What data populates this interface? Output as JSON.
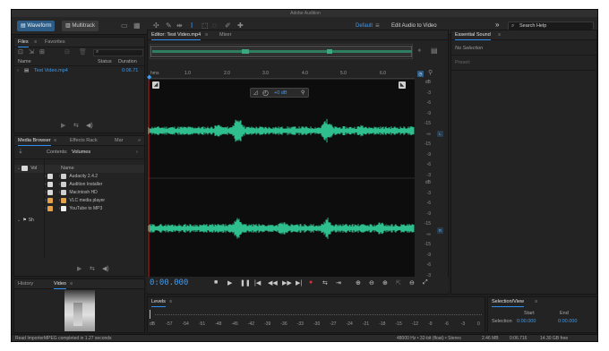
{
  "window": {
    "title": "Adobe Audition"
  },
  "toolbar": {
    "waveform_label": "Waveform",
    "multitrack_label": "Multitrack",
    "workspace_label": "Default",
    "edit_audio_video_label": "Edit Audio to Video",
    "search_placeholder": "Search Help"
  },
  "files_panel": {
    "tabs": [
      "Files",
      "Favorites"
    ],
    "columns": {
      "name": "Name",
      "status": "Status",
      "duration": "Duration"
    },
    "files": [
      {
        "name": "Test Video.mp4",
        "duration": "0:06.71"
      }
    ]
  },
  "media_browser": {
    "tabs": [
      "Media Browser",
      "Effects Rack",
      "Mar"
    ],
    "contents_label": "Contents:",
    "contents_value": "Volumes",
    "left_items": [
      "Vol",
      "Sh"
    ],
    "name_header": "Name",
    "items": [
      "Audacity 2.4.2",
      "Audition Installer",
      "Macintosh HD",
      "VLC media player",
      "YouTube to MP3"
    ]
  },
  "history_panel": {
    "tabs": [
      "History",
      "Video"
    ]
  },
  "editor": {
    "tabs": [
      "Editor: Test Video.mp4",
      "Mixer"
    ],
    "ruler_unit": "hms",
    "ruler_ticks": [
      "1.0",
      "2.0",
      "3.0",
      "4.0",
      "5.0",
      "6.0"
    ],
    "volume_label": "+0 dB",
    "db_scale_top": [
      "dB",
      "-3",
      "-6",
      "-9",
      "-15",
      "-∞",
      "-15",
      "-9",
      "-6",
      "-3"
    ],
    "db_scale_bottom": [
      "dB",
      "-3",
      "-6",
      "-9",
      "-15",
      "-∞",
      "-15",
      "-9",
      "-6",
      "-3"
    ],
    "channel_left": "L",
    "channel_right": "R",
    "time_display": "0:00.000"
  },
  "essential_sound": {
    "title": "Essential Sound",
    "no_selection": "No Selection",
    "preset_label": "Preset:"
  },
  "levels_panel": {
    "title": "Levels",
    "scale": [
      "dB",
      "-57",
      "-54",
      "-51",
      "-48",
      "-45",
      "-42",
      "-39",
      "-36",
      "-33",
      "-30",
      "-27",
      "-24",
      "-21",
      "-18",
      "-15",
      "-12",
      "-9",
      "-6",
      "-3",
      "0"
    ]
  },
  "selection_view": {
    "title": "Selection/View",
    "start_header": "Start",
    "end_header": "End",
    "selection_label": "Selection",
    "start_value": "0:00.000",
    "end_value": "0:00.000"
  },
  "statusbar": {
    "message": "Read ImporterMPEG completed in 1.27 seconds",
    "format": "48000 Hz • 32-bit (float) • Stereo",
    "size": "2.46 MB",
    "duration": "0:06.716",
    "free": "14.30 GB free"
  },
  "colors": {
    "accent": "#2f8ef0",
    "waveform": "#2fbf8f",
    "playhead": "#d02020"
  }
}
